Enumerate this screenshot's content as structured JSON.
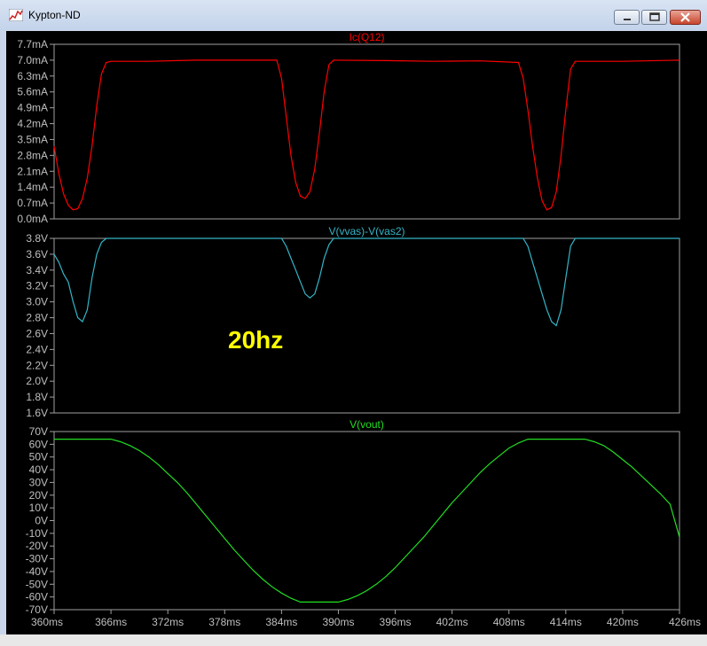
{
  "window": {
    "title": "Kypton-ND",
    "icon": "waveform-chart-icon"
  },
  "controls": {
    "minimize_icon": "minimize-icon",
    "maximize_icon": "maximize-icon",
    "close_icon": "close-icon"
  },
  "colors": {
    "background": "#000000",
    "axis": "#a0a0a0",
    "tick_text": "#bfbfbf",
    "ic_trace": "#ff0000",
    "vvas_trace": "#33b5c8",
    "vout_trace": "#22dd22",
    "annotation": "#ffff00"
  },
  "chart_data": [
    {
      "type": "line",
      "title": "Ic(Q12)",
      "ylim": [
        0,
        7.7
      ],
      "xlim": [
        360,
        426
      ],
      "grid": false,
      "yticks": [
        "7.7mA",
        "7.0mA",
        "6.3mA",
        "5.6mA",
        "4.9mA",
        "4.2mA",
        "3.5mA",
        "2.8mA",
        "2.1mA",
        "1.4mA",
        "0.7mA",
        "0.0mA"
      ],
      "series": [
        {
          "name": "Ic(Q12)",
          "x": [
            360,
            360.5,
            361,
            361.5,
            362,
            362.5,
            363,
            363.5,
            364,
            364.5,
            365,
            365.5,
            366,
            370,
            375,
            380,
            383.5,
            384,
            384.5,
            385,
            385.5,
            386,
            386.5,
            387,
            387.5,
            388,
            388.5,
            389,
            389.5,
            395,
            400,
            405,
            409,
            409.5,
            410,
            410.5,
            411,
            411.5,
            412,
            412.5,
            413,
            413.5,
            414,
            414.5,
            415,
            420,
            426
          ],
          "y": [
            3.2,
            2.0,
            1.1,
            0.6,
            0.4,
            0.45,
            0.9,
            1.8,
            3.2,
            5.0,
            6.4,
            6.9,
            6.95,
            6.95,
            7.0,
            7.0,
            7.0,
            6.2,
            4.5,
            2.8,
            1.6,
            1.0,
            0.9,
            1.2,
            2.2,
            3.8,
            5.6,
            6.8,
            7.0,
            6.98,
            6.95,
            6.97,
            6.9,
            6.2,
            4.8,
            3.2,
            1.8,
            0.8,
            0.4,
            0.5,
            1.2,
            2.8,
            4.8,
            6.6,
            6.95,
            6.95,
            7.0
          ]
        }
      ]
    },
    {
      "type": "line",
      "title": "V(vvas)-V(vas2)",
      "ylim": [
        1.6,
        3.8
      ],
      "xlim": [
        360,
        426
      ],
      "grid": false,
      "yticks": [
        "3.8V",
        "3.6V",
        "3.4V",
        "3.2V",
        "3.0V",
        "2.8V",
        "2.6V",
        "2.4V",
        "2.2V",
        "2.0V",
        "1.8V",
        "1.6V"
      ],
      "series": [
        {
          "name": "V(vvas)-V(vas2)",
          "x": [
            360,
            360.5,
            361,
            361.5,
            362,
            362.5,
            363,
            363.5,
            364,
            364.5,
            365,
            365.5,
            366,
            370,
            375,
            380,
            384,
            384.5,
            385,
            385.5,
            386,
            386.5,
            387,
            387.5,
            388,
            388.5,
            389,
            389.5,
            390,
            395,
            400,
            405,
            409.5,
            410,
            410.5,
            411,
            411.5,
            412,
            412.5,
            413,
            413.5,
            414,
            414.5,
            415,
            420,
            426
          ],
          "y": [
            3.6,
            3.5,
            3.35,
            3.25,
            3.0,
            2.8,
            2.75,
            2.9,
            3.3,
            3.6,
            3.75,
            3.8,
            3.8,
            3.8,
            3.8,
            3.8,
            3.8,
            3.7,
            3.55,
            3.4,
            3.25,
            3.1,
            3.05,
            3.1,
            3.3,
            3.55,
            3.72,
            3.8,
            3.8,
            3.8,
            3.8,
            3.8,
            3.8,
            3.7,
            3.5,
            3.3,
            3.1,
            2.9,
            2.75,
            2.7,
            2.9,
            3.3,
            3.7,
            3.8,
            3.8,
            3.8
          ]
        }
      ],
      "annotation": "20hz"
    },
    {
      "type": "line",
      "title": "V(vout)",
      "ylim": [
        -70,
        70
      ],
      "xlim": [
        360,
        426
      ],
      "grid": false,
      "yticks": [
        "70V",
        "60V",
        "50V",
        "40V",
        "30V",
        "20V",
        "10V",
        "0V",
        "-10V",
        "-20V",
        "-30V",
        "-40V",
        "-50V",
        "-60V",
        "-70V"
      ],
      "series": [
        {
          "name": "V(vout)",
          "x": [
            360,
            361,
            362,
            363,
            364,
            365,
            366,
            367,
            368,
            369,
            370,
            371,
            372,
            373,
            374,
            375,
            376,
            377,
            378,
            379,
            380,
            381,
            382,
            383,
            384,
            385,
            386,
            387,
            388,
            389,
            390,
            391,
            392,
            393,
            394,
            395,
            396,
            397,
            398,
            399,
            400,
            401,
            402,
            403,
            404,
            405,
            406,
            407,
            408,
            409,
            410,
            411,
            412,
            413,
            414,
            415,
            416,
            417,
            418,
            419,
            420,
            421,
            422,
            423,
            424,
            425,
            426
          ],
          "y": [
            64,
            64,
            64,
            64,
            64,
            64,
            64,
            62,
            59,
            55,
            50,
            44,
            37,
            30,
            22,
            13,
            4,
            -5,
            -14,
            -23,
            -31,
            -39,
            -46,
            -52,
            -57,
            -61,
            -64,
            -64,
            -64,
            -64,
            -64,
            -62,
            -59,
            -55,
            -50,
            -44,
            -37,
            -29,
            -21,
            -13,
            -4,
            5,
            14,
            22,
            30,
            38,
            45,
            51,
            57,
            61,
            64,
            64,
            64,
            64,
            64,
            64,
            64,
            62,
            59,
            54,
            48,
            42,
            35,
            28,
            21,
            13,
            -13
          ]
        }
      ]
    }
  ],
  "x_axis": {
    "ticks": [
      "360ms",
      "366ms",
      "372ms",
      "378ms",
      "384ms",
      "390ms",
      "396ms",
      "402ms",
      "408ms",
      "414ms",
      "420ms",
      "426ms"
    ]
  }
}
